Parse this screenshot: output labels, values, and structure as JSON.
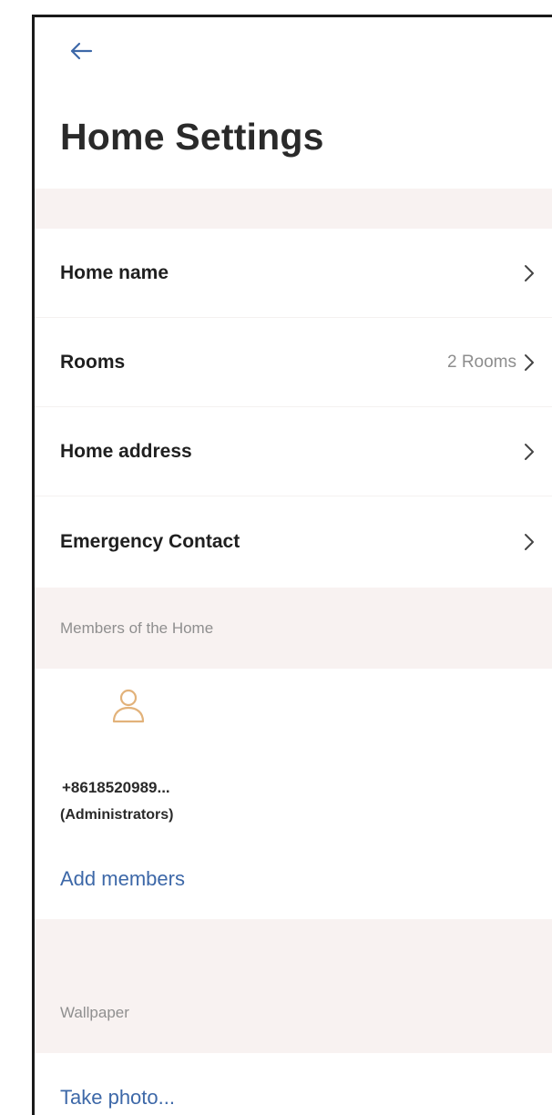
{
  "header": {
    "title": "Home Settings"
  },
  "settings": {
    "rows": [
      {
        "label": "Home name",
        "value": ""
      },
      {
        "label": "Rooms",
        "value": "2 Rooms"
      },
      {
        "label": "Home address",
        "value": ""
      },
      {
        "label": "Emergency Contact",
        "value": ""
      }
    ]
  },
  "members": {
    "section_title": "Members of the Home",
    "list": [
      {
        "name": "+8618520989...",
        "role": "(Administrators)"
      }
    ],
    "add_label": "Add members"
  },
  "wallpaper": {
    "section_title": "Wallpaper",
    "take_photo_label": "Take photo..."
  },
  "colors": {
    "accent": "#3d68a8",
    "avatar": "#e2b27a",
    "band": "#f8f2f1"
  },
  "icons": {
    "back": "arrow-left-icon",
    "chevron": "chevron-right-icon",
    "avatar": "person-icon"
  }
}
